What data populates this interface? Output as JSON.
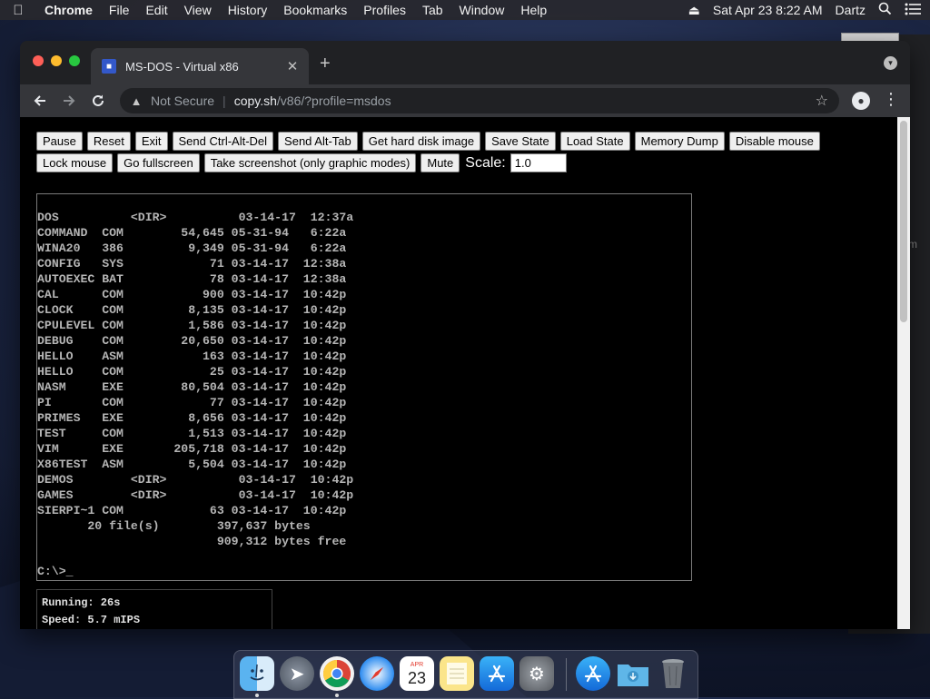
{
  "menubar": {
    "app_name": "Chrome",
    "items": [
      "File",
      "Edit",
      "View",
      "History",
      "Bookmarks",
      "Profiles",
      "Tab",
      "Window",
      "Help"
    ],
    "clock": "Sat Apr 23  8:22 AM",
    "user": "Dartz"
  },
  "browser": {
    "tab_title": "MS-DOS - Virtual x86",
    "url_security": "Not Secure",
    "url_host": "copy.sh",
    "url_path": "/v86/?profile=msdos"
  },
  "controls": {
    "row1": [
      "Pause",
      "Reset",
      "Exit",
      "Send Ctrl-Alt-Del",
      "Send Alt-Tab",
      "Get hard disk image",
      "Save State",
      "Load State",
      "Memory Dump",
      "Disable mouse"
    ],
    "row2": [
      "Lock mouse",
      "Go fullscreen",
      "Take screenshot (only graphic modes)",
      "Mute"
    ],
    "scale_label": "Scale:",
    "scale_value": "1.0"
  },
  "dos": {
    "listing": [
      "DOS          <DIR>          03-14-17  12:37a",
      "COMMAND  COM        54,645 05-31-94   6:22a",
      "WINA20   386         9,349 05-31-94   6:22a",
      "CONFIG   SYS            71 03-14-17  12:38a",
      "AUTOEXEC BAT            78 03-14-17  12:38a",
      "CAL      COM           900 03-14-17  10:42p",
      "CLOCK    COM         8,135 03-14-17  10:42p",
      "CPULEVEL COM         1,586 03-14-17  10:42p",
      "DEBUG    COM        20,650 03-14-17  10:42p",
      "HELLO    ASM           163 03-14-17  10:42p",
      "HELLO    COM            25 03-14-17  10:42p",
      "NASM     EXE        80,504 03-14-17  10:42p",
      "PI       COM            77 03-14-17  10:42p",
      "PRIMES   EXE         8,656 03-14-17  10:42p",
      "TEST     COM         1,513 03-14-17  10:42p",
      "VIM      EXE       205,718 03-14-17  10:42p",
      "X86TEST  ASM         5,504 03-14-17  10:42p",
      "DEMOS        <DIR>          03-14-17  10:42p",
      "GAMES        <DIR>          03-14-17  10:42p",
      "SIERPI~1 COM            63 03-14-17  10:42p",
      "       20 file(s)        397,637 bytes",
      "                         909,312 bytes free"
    ],
    "prompt": "C:\\>_"
  },
  "stats": {
    "running": "Running: 26s",
    "speed": "Speed: 5.7 mIPS"
  },
  "dock": {
    "calendar_month": "APR",
    "calendar_day": "23",
    "apps": [
      "finder-icon",
      "launchpad-icon",
      "chrome-icon",
      "safari-icon",
      "calendar-icon",
      "notes-icon",
      "app-store-icon",
      "system-preferences-icon",
      "app-store-icon",
      "downloads-folder-icon",
      "trash-icon"
    ]
  }
}
